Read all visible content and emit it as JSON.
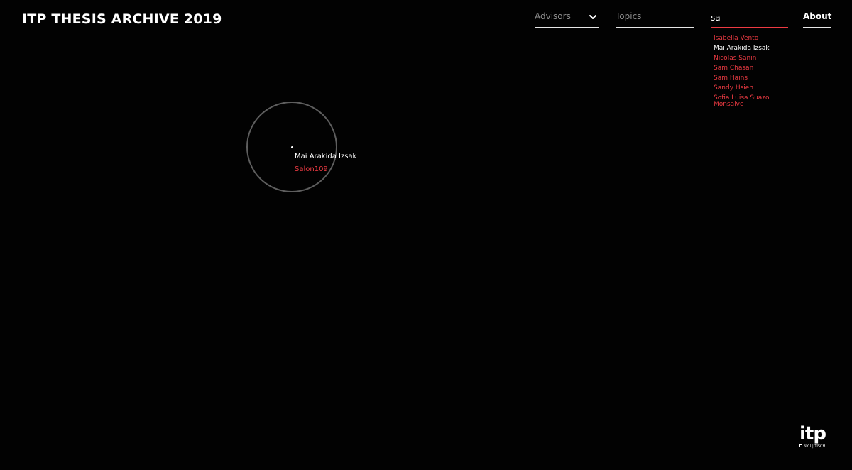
{
  "header": {
    "title": "ITP THESIS ARCHIVE 2019",
    "advisors_label": "Advisors",
    "topics_label": "Topics",
    "search_value": "sa",
    "about_label": "About"
  },
  "search_results": [
    {
      "label": "Isabella Vento",
      "active": false
    },
    {
      "label": "Mai Arakida Izsak",
      "active": true
    },
    {
      "label": "Nicolas Sanin",
      "active": false
    },
    {
      "label": "Sam Chasan",
      "active": false
    },
    {
      "label": "Sam Hains",
      "active": false
    },
    {
      "label": "Sandy Hsieh",
      "active": false
    },
    {
      "label": "Sofia Luisa Suazo Monsalve",
      "active": false
    }
  ],
  "focused_node": {
    "name": "Mai Arakida Izsak",
    "project": "Salon109"
  },
  "logo": {
    "word": "itp",
    "sub": "NYU | TISCH"
  },
  "colors": {
    "background": "#020202",
    "accent": "#ee3b43",
    "text": "#ffffff",
    "muted": "#8d8d8d"
  },
  "icons": {
    "advisors_dropdown": "chevron-down-icon",
    "logo_square": "square-icon"
  }
}
